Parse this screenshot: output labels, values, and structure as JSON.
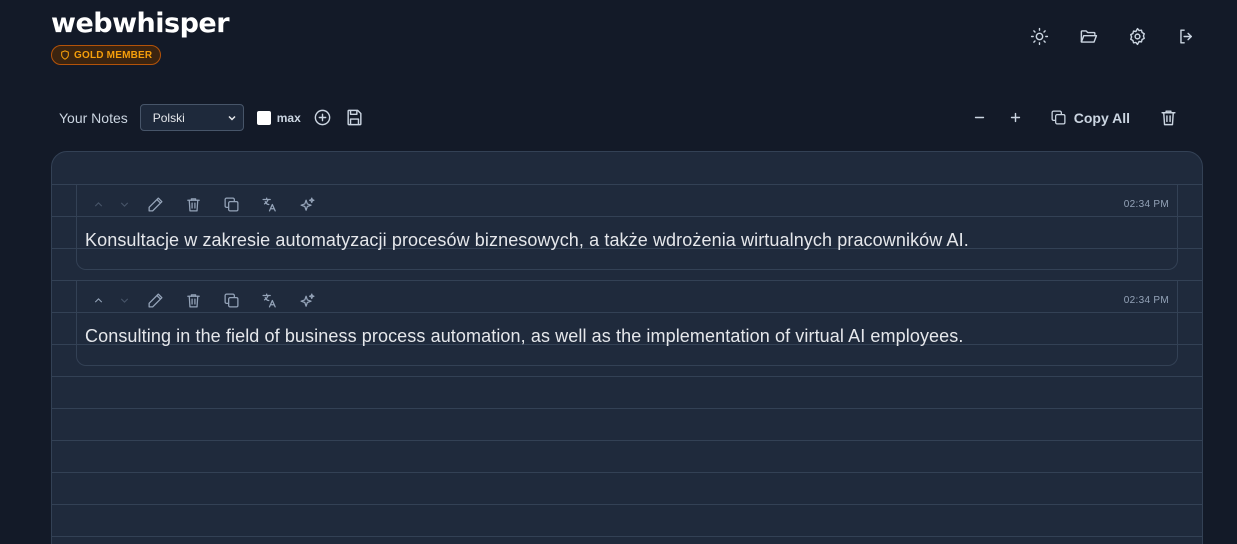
{
  "app": {
    "title": "webwhisper",
    "badge": "GOLD MEMBER"
  },
  "header_icons": [
    "sun-icon",
    "folder-open-icon",
    "settings-gear-icon",
    "logout-icon"
  ],
  "toolbar": {
    "notes_label": "Your Notes",
    "language": "Polski",
    "max_label": "max",
    "max_checked": false,
    "copy_all_label": "Copy All"
  },
  "notes": [
    {
      "time": "02:34 PM",
      "text": "Konsultacje w zakresie automatyzacji procesów biznesowych, a także wdrożenia wirtualnych pracowników AI."
    },
    {
      "time": "02:34 PM",
      "text": "Consulting in the field of business process automation, as well as the implementation of virtual AI employees."
    }
  ],
  "colors": {
    "background": "#131a28",
    "paper": "#1f2a3c",
    "badge_accent": "#f59e0b"
  }
}
